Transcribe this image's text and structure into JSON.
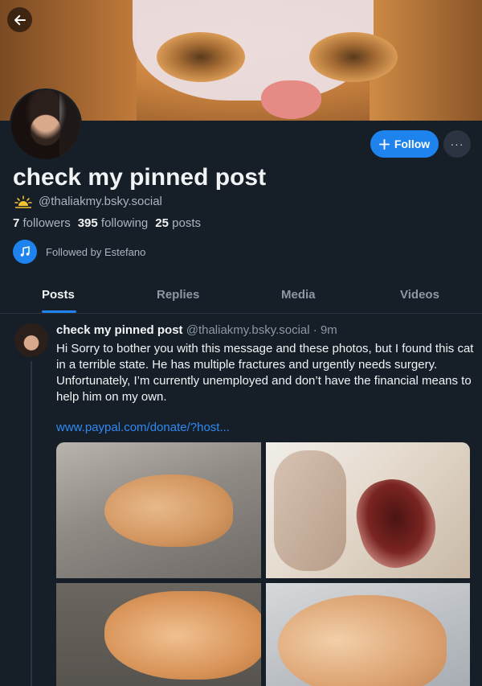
{
  "profile": {
    "display_name": "check my pinned post",
    "handle": "@thaliakmy.bsky.social",
    "handle_icon": "sunrise-icon",
    "followers_count": "7",
    "followers_label": "followers",
    "following_count": "395",
    "following_label": "following",
    "posts_count": "25",
    "posts_label": "posts",
    "followed_by": "Followed by Estefano"
  },
  "actions": {
    "follow_label": "Follow",
    "more_label": "···"
  },
  "tabs": [
    {
      "label": "Posts",
      "active": true
    },
    {
      "label": "Replies",
      "active": false
    },
    {
      "label": "Media",
      "active": false
    },
    {
      "label": "Videos",
      "active": false
    }
  ],
  "post": {
    "author": "check my pinned post",
    "handle": "@thaliakmy.bsky.social",
    "time": "· 9m",
    "text_1": "Hi Sorry to bother you with this message and these photos, but I found this cat in a terrible state. He has multiple fractures and urgently needs surgery.",
    "text_2": "Unfortunately, I’m currently unemployed and don’t have the financial means to help him on my own.",
    "link": "www.paypal.com/donate/?host..."
  },
  "colors": {
    "background": "#161e27",
    "accent": "#1f83ee",
    "muted_text": "#aab5c2"
  }
}
